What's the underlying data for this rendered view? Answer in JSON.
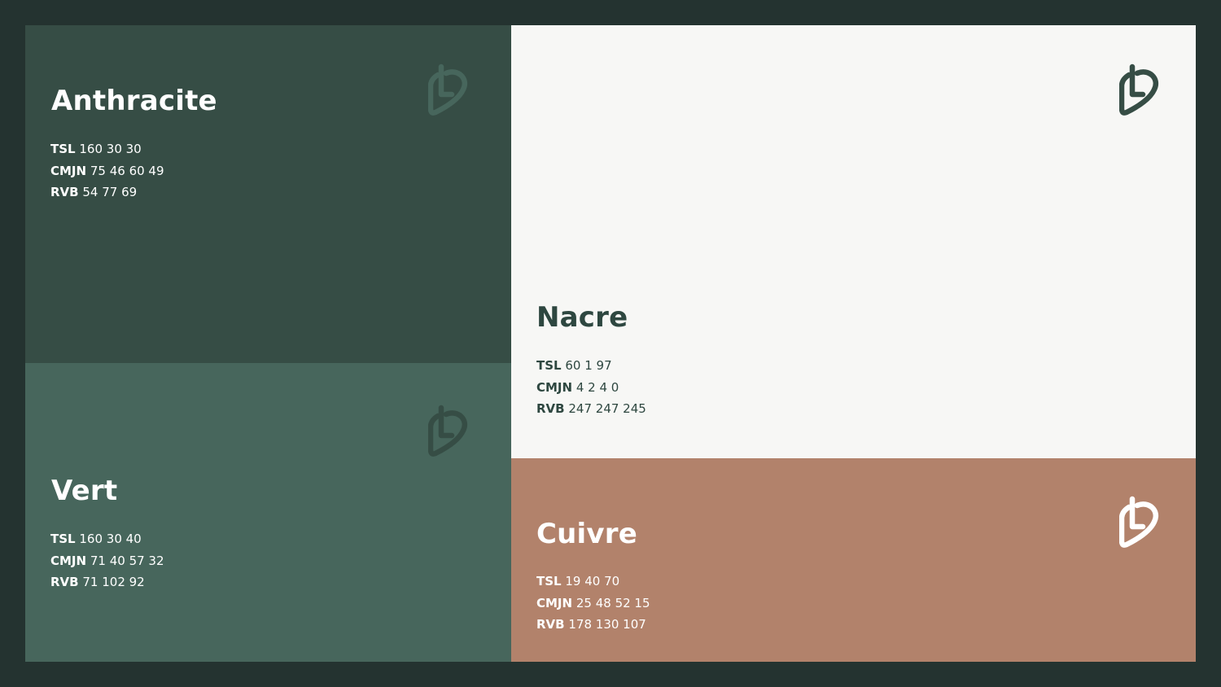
{
  "palette": {
    "anthracite": {
      "name": "Anthracite",
      "tsl_label": "TSL",
      "tsl": "160 30 30",
      "cmjn_label": "CMJN",
      "cmjn": "75 46 60 49",
      "rvb_label": "RVB",
      "rvb": "54 77 69",
      "color": "#364D45",
      "logo_icon": "leaf-l-logo-icon",
      "logo_color": "#47665C"
    },
    "nacre": {
      "name": "Nacre",
      "tsl_label": "TSL",
      "tsl": "60 1 97",
      "cmjn_label": "CMJN",
      "cmjn": "4 2 4 0",
      "rvb_label": "RVB",
      "rvb": "247 247 245",
      "color": "#F7F7F5",
      "logo_icon": "leaf-l-logo-icon",
      "logo_color": "#364D45"
    },
    "vert": {
      "name": "Vert",
      "tsl_label": "TSL",
      "tsl": "160 30 40",
      "cmjn_label": "CMJN",
      "cmjn": "71 40 57 32",
      "rvb_label": "RVB",
      "rvb": "71 102 92",
      "color": "#47665C",
      "logo_icon": "leaf-l-logo-icon",
      "logo_color": "#364D45"
    },
    "cuivre": {
      "name": "Cuivre",
      "tsl_label": "TSL",
      "tsl": "19 40 70",
      "cmjn_label": "CMJN",
      "cmjn": "25 48 52 15",
      "rvb_label": "RVB",
      "rvb": "178 130 107",
      "color": "#B2826B",
      "logo_icon": "leaf-l-logo-icon",
      "logo_color": "#FFFFFF"
    }
  },
  "background_color": "#243330"
}
